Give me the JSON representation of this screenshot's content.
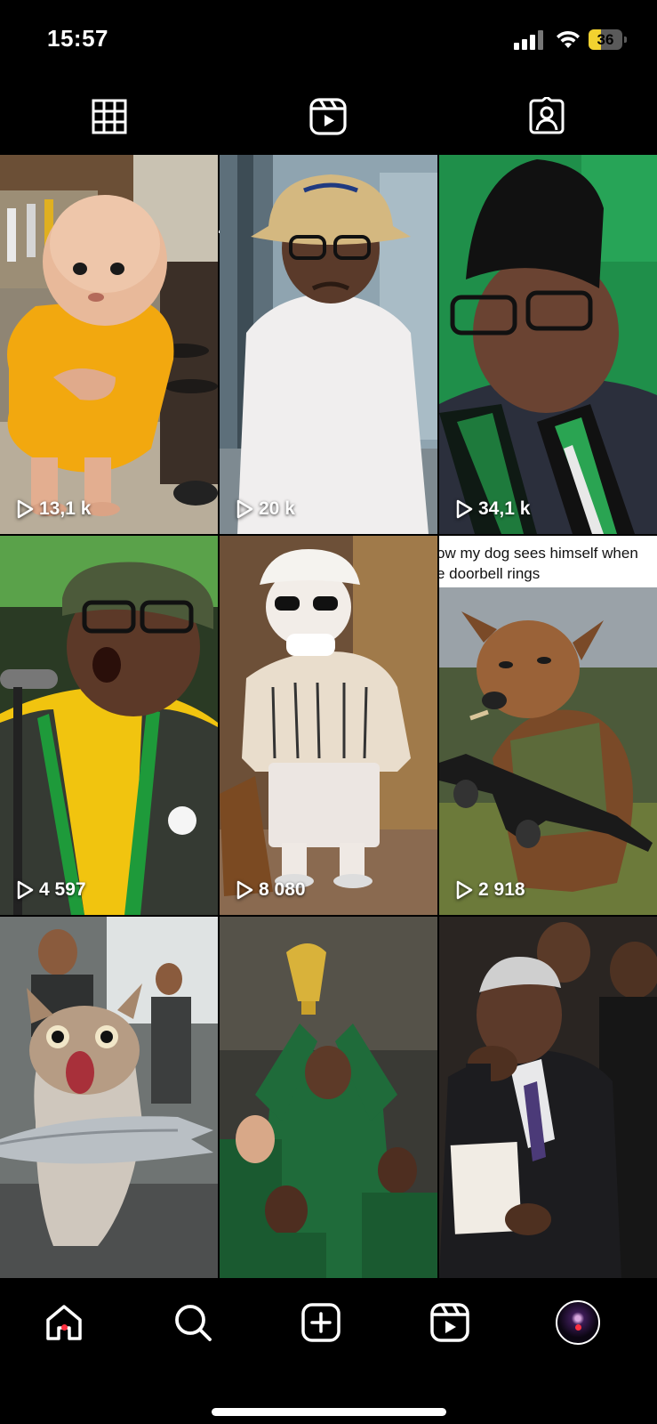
{
  "status_bar": {
    "time": "15:57",
    "battery_percent": "36",
    "battery_level": 0.36,
    "signal_icon": "cellular-signal-icon",
    "wifi_icon": "wifi-icon"
  },
  "profile_tabs": [
    {
      "name": "posts",
      "icon": "grid-icon",
      "selected": false
    },
    {
      "name": "reels",
      "icon": "reels-icon",
      "selected": true
    },
    {
      "name": "tagged",
      "icon": "tagged-person-icon",
      "selected": false
    }
  ],
  "reels": [
    {
      "views": "13,1 k",
      "subject": "baby monk in yellow robe"
    },
    {
      "views": "20 k",
      "subject": "man in bucket hat and white shirt"
    },
    {
      "views": "34,1 k",
      "subject": "man in black hat and ANC scarf"
    },
    {
      "views": "4 597",
      "subject": "man in camo cap speaking at microphone"
    },
    {
      "views": "8 080",
      "subject": "cat in cap and sweater"
    },
    {
      "views": "2 918",
      "subject": "dog with rifle meme",
      "caption_lines": [
        "ow my dog sees himself when",
        "e doorbell rings"
      ]
    },
    {
      "views": "",
      "subject": "cat carrying fish"
    },
    {
      "views": "",
      "subject": "man raising trophy with players"
    },
    {
      "views": "",
      "subject": "man in suit holding paper"
    }
  ],
  "bottom_nav": [
    {
      "name": "home",
      "icon": "home-icon",
      "has_dot": true
    },
    {
      "name": "search",
      "icon": "search-icon",
      "has_dot": false
    },
    {
      "name": "create",
      "icon": "plus-square-icon",
      "has_dot": false
    },
    {
      "name": "reels",
      "icon": "reels-icon",
      "has_dot": false
    },
    {
      "name": "profile",
      "icon": "profile-avatar",
      "has_dot": true
    }
  ],
  "colors": {
    "background": "#000000",
    "notification_dot": "#ff3040",
    "battery": "#f2d230"
  }
}
